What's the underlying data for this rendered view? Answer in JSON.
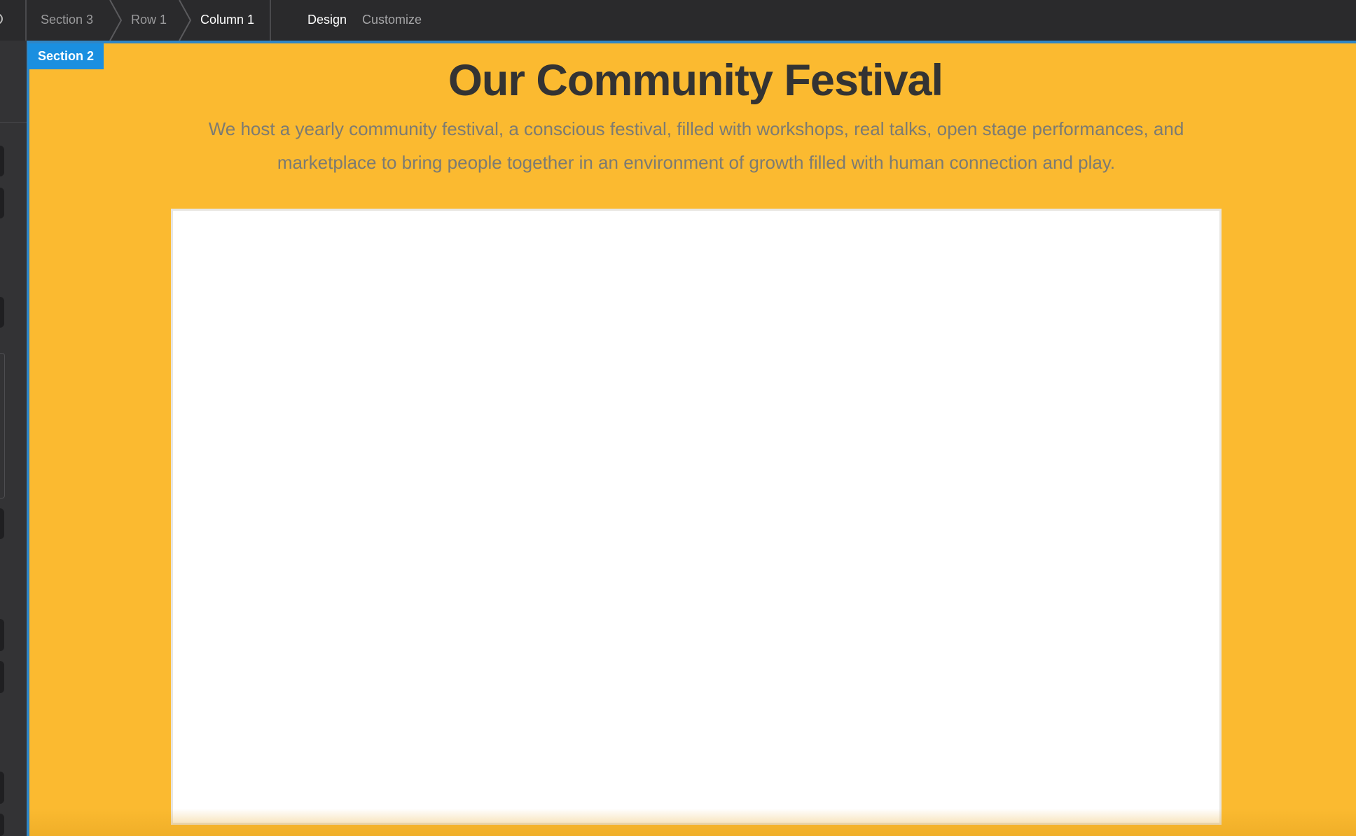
{
  "toolbar": {
    "breadcrumbs": [
      {
        "label": "Section 3"
      },
      {
        "label": "Row 1"
      },
      {
        "label": "Column 1"
      }
    ],
    "tabs": {
      "design": "Design",
      "customize": "Customize"
    }
  },
  "canvas": {
    "section_label": "Section 2",
    "title": "Our Community Festival",
    "description": "We host a yearly community festival, a conscious festival, filled with workshops, real talks, open stage performances, and marketplace to bring people together in an environment of growth filled with human connection and play."
  },
  "colors": {
    "toolbar_bg": "#2a2a2c",
    "section_bg": "#fbba30",
    "selection_blue": "#1a8fe0",
    "title_text": "#333333",
    "description_text": "#7c7b72"
  }
}
